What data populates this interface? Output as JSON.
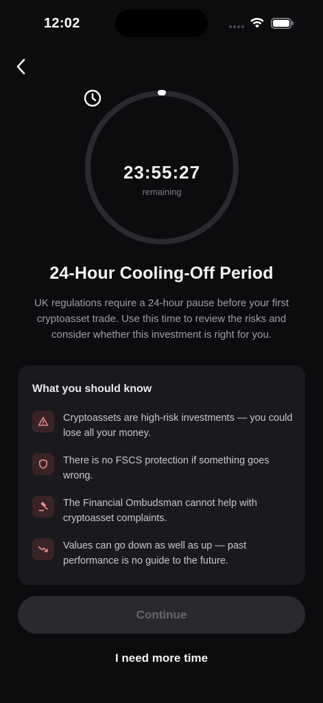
{
  "status_bar": {
    "time": "12:02",
    "icons": [
      "signal-dots-icon",
      "wifi-icon",
      "battery-icon"
    ]
  },
  "nav": {
    "back_icon": "chevron-left-icon"
  },
  "timer": {
    "value": "23:55:27",
    "caption": "remaining",
    "icon": "clock-icon",
    "progress_remaining_fraction": 0.997
  },
  "title": "24-Hour Cooling-Off Period",
  "description": "UK regulations require a 24-hour pause before your first cryptoasset trade. Use this time to review the risks and consider whether this investment is right for you.",
  "info_card": {
    "title": "What you should know",
    "items": [
      {
        "icon": "warning-triangle-icon",
        "text": "Cryptoassets are high-risk investments — you could lose all your money."
      },
      {
        "icon": "shield-icon",
        "text": "There is no FSCS protection if something goes wrong."
      },
      {
        "icon": "gavel-icon",
        "text": "The Financial Ombudsman cannot help with cryptoasset complaints."
      },
      {
        "icon": "trending-down-icon",
        "text": "Values can go down as well as up — past performance is no guide to the future."
      }
    ]
  },
  "actions": {
    "continue_label": "Continue",
    "more_time_label": "I need more time"
  },
  "colors": {
    "background": "#0c0b0e",
    "card": "#1a191d",
    "risk_icon_bg": "#3a2326",
    "risk_icon": "#e98a8f",
    "disabled_button": "#2a292d"
  }
}
